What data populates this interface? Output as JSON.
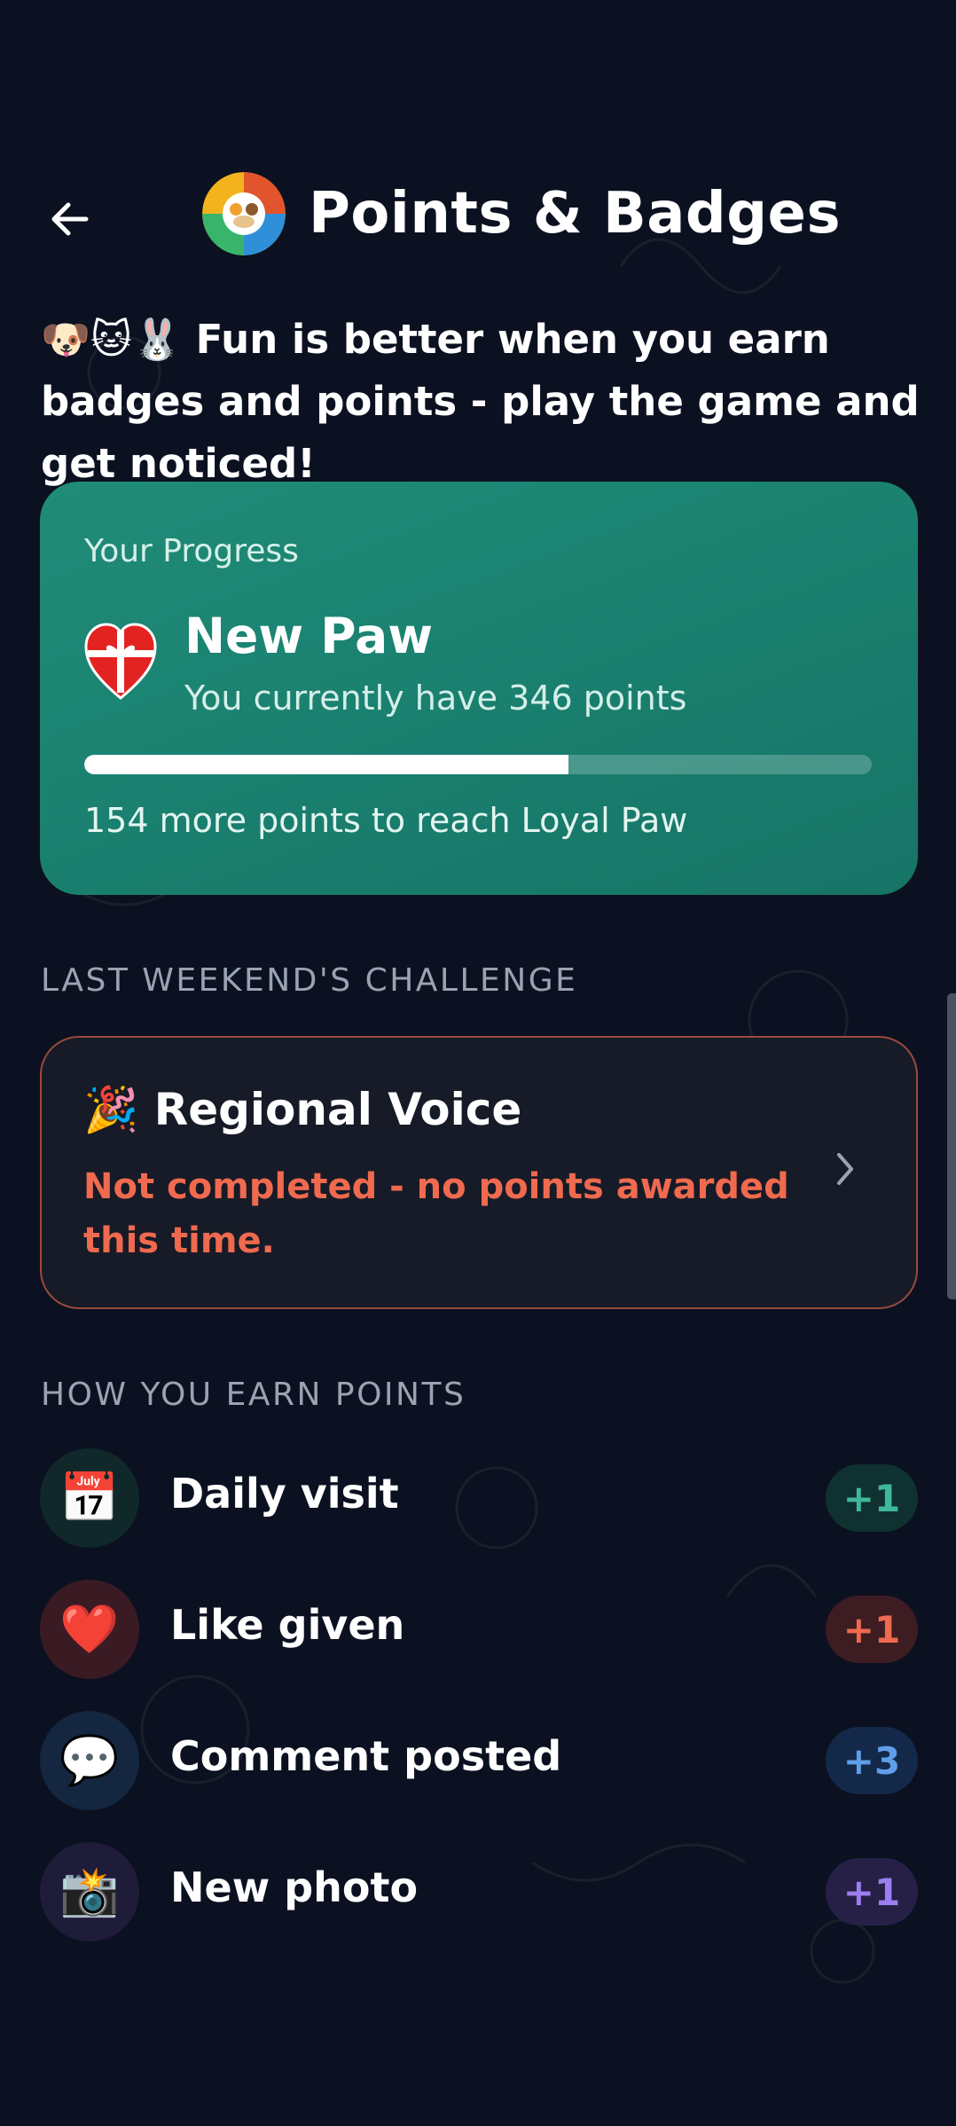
{
  "header": {
    "title": "Points & Badges",
    "back_icon": "arrow-left-icon",
    "logo_icon": "pets-circle-logo"
  },
  "intro": {
    "emojis": "🐶🐱🐰",
    "text": "Fun is better when you earn badges and points - play the game and get noticed!"
  },
  "progress": {
    "label": "Your Progress",
    "badge_icon": "heart-gift-icon",
    "level_name": "New Paw",
    "current_points_text": "You currently have 346 points",
    "current_points": 346,
    "progress_fraction": 0.615,
    "next_text": "154 more points to reach Loyal Paw"
  },
  "challenge": {
    "section_heading": "LAST WEEKEND'S CHALLENGE",
    "icon": "🎉",
    "title": "Regional Voice",
    "status": "Not completed - no points awarded this time."
  },
  "earn": {
    "section_heading": "HOW YOU EARN POINTS",
    "items": [
      {
        "icon": "📅",
        "icon_name": "calendar-icon",
        "label": "Daily visit",
        "points": "+1",
        "icon_bg": "#10282a",
        "badge_bg": "#0f3230",
        "badge_color": "#3fb89a"
      },
      {
        "icon": "❤️",
        "icon_name": "heart-icon",
        "label": "Like given",
        "points": "+1",
        "icon_bg": "#3a1b24",
        "badge_bg": "#3d1d22",
        "badge_color": "#ef6a4f"
      },
      {
        "icon": "💬",
        "icon_name": "speech-bubble-icon",
        "label": "Comment posted",
        "points": "+3",
        "icon_bg": "#142640",
        "badge_bg": "#14294a",
        "badge_color": "#5f9ee8"
      },
      {
        "icon": "📸",
        "icon_name": "camera-flash-icon",
        "label": "New photo",
        "points": "+1",
        "icon_bg": "#1f1c3a",
        "badge_bg": "#262047",
        "badge_color": "#9b7ff0"
      }
    ]
  }
}
